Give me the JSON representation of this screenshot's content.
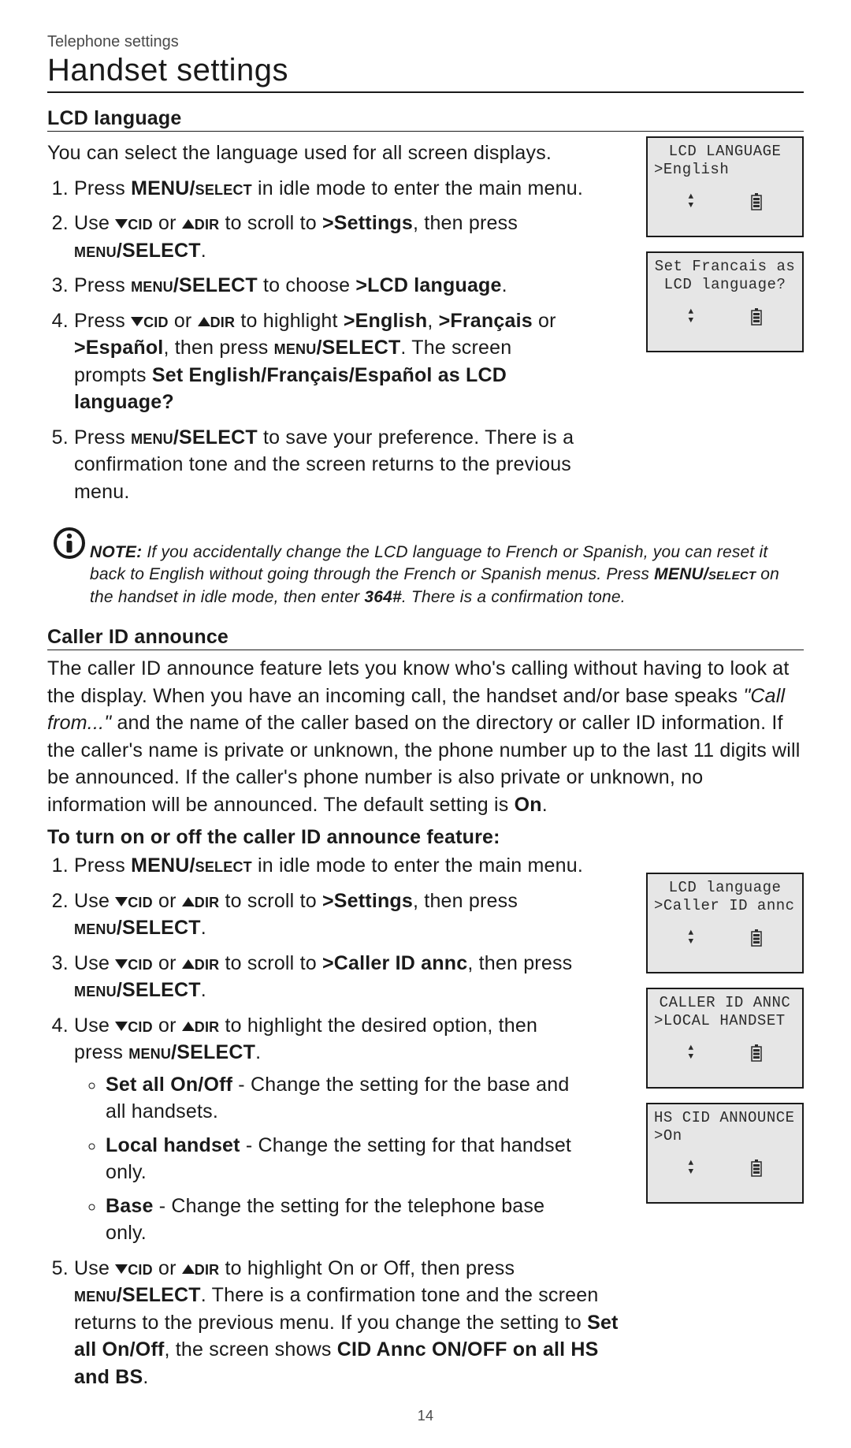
{
  "breadcrumb": "Telephone settings",
  "title": "Handset settings",
  "sections": {
    "lcd_language": {
      "heading": "LCD language",
      "intro": "You can select the language used for all screen displays.",
      "steps": [
        {
          "prefix": "Press ",
          "key1": "MENU/",
          "key1_sc": "select",
          "suffix": " in idle mode to enter the main menu."
        },
        {
          "t0": "Use ",
          "key_cid": "cid",
          "t1": " or ",
          "key_dir": "dir",
          "t2": " to scroll to ",
          "settings": ">Settings",
          "t3": ", then press ",
          "menu_sc": "menu",
          "menu_sel": "/SELECT",
          "t4": "."
        },
        {
          "t0": "Press ",
          "menu_sc": "menu",
          "menu_sel": "/SELECT",
          "t1": " to choose ",
          "target": ">LCD language",
          "t2": "."
        },
        {
          "t0": "Press ",
          "key_cid": "cid",
          "t1": " or ",
          "key_dir": "dir",
          "t2": " to highlight ",
          "opt1": ">English",
          "comma1": ", ",
          "opt2": ">Français",
          "t3": " or ",
          "opt3": ">Español",
          "t4": ", then press ",
          "menu_sc": "menu",
          "menu_sel": "/SELECT",
          "t5": ". The screen prompts ",
          "prompt": "Set English/Français/Español as LCD language?"
        },
        {
          "t0": "Press ",
          "menu_sc": "menu",
          "menu_sel": "/SELECT",
          "t1": " to save your preference. There is a confirmation tone and the screen returns to the previous menu."
        }
      ],
      "screens": [
        {
          "line1": "LCD LANGUAGE",
          "line2": ">English"
        },
        {
          "line1": "Set Francais as",
          "line2": "LCD language?"
        }
      ]
    },
    "note": {
      "label": "NOTE:",
      "t0": " If you accidentally change the LCD language to French or Spanish, you can reset it back to English without going through the French or Spanish menus. Press ",
      "key1": "MENU/",
      "key1_sc": "select",
      "t1": " on the handset in idle mode, then enter ",
      "code": "364#",
      "t2": ". There is a confirmation tone."
    },
    "caller_id": {
      "heading": "Caller ID announce",
      "intro_t0": "The caller ID announce feature lets you know who's calling without having to look at the display. When you have an incoming call, the handset and/or base speaks ",
      "intro_quote": "\"Call from...\"",
      "intro_t1": " and the name of the caller based on the directory or caller ID information. If the caller's name is private or unknown, the phone number up to the last 11 digits will be announced. If the caller's phone number is also private or unknown, no information will be announced. The default setting is ",
      "intro_on": "On",
      "intro_t2": ".",
      "subhead": "To turn on or off the caller ID announce feature:",
      "steps": [
        {
          "t0": "Press ",
          "key1": "MENU/",
          "key1_sc": "select",
          "t1": " in idle mode to enter the main menu."
        },
        {
          "t0": "Use ",
          "key_cid": "cid",
          "t1": " or ",
          "key_dir": "dir",
          "t2": " to scroll to ",
          "settings": ">Settings",
          "t3": ", then press ",
          "menu_sc": "menu",
          "menu_sel": "/SELECT",
          "t4": "."
        },
        {
          "t0": "Use ",
          "key_cid": "cid",
          "t1": " or ",
          "key_dir": "dir",
          "t2": " to scroll to ",
          "target": ">Caller ID annc",
          "t3": ", then press ",
          "menu_sc": "menu",
          "menu_sel": "/SELECT",
          "t4": "."
        },
        {
          "t0": "Use ",
          "key_cid": "cid",
          "t1": " or ",
          "key_dir": "dir",
          "t2": " to highlight the desired option, then press ",
          "menu_sc": "menu",
          "menu_sel": "/SELECT",
          "t3": "."
        },
        {
          "t0": "Use ",
          "key_cid": "cid",
          "t1": " or ",
          "key_dir": "dir",
          "t2": " to highlight On or Off, then press ",
          "menu_sc": "menu",
          "menu_sel": "/SELECT",
          "t3": ". There is a confirmation tone and the screen returns to the previous menu. If you change the setting to ",
          "setall": "Set all On/Off",
          "t4": ", the screen shows ",
          "result": "CID Annc ON/OFF on all HS and BS",
          "t5": "."
        }
      ],
      "bullets": [
        {
          "label": "Set all On/Off",
          "desc": " - Change the setting for the base and all handsets."
        },
        {
          "label": "Local handset",
          "desc": " - Change the setting for that handset only."
        },
        {
          "label": "Base",
          "desc": " - Change the setting for the telephone base only."
        }
      ],
      "screens": [
        {
          "line1": "LCD language",
          "line2": ">Caller ID annc"
        },
        {
          "line1": "CALLER ID ANNC",
          "line2": ">LOCAL HANDSET"
        },
        {
          "line1": "HS CID ANNOUNCE",
          "line2": ">On"
        }
      ]
    }
  },
  "page_number": "14"
}
